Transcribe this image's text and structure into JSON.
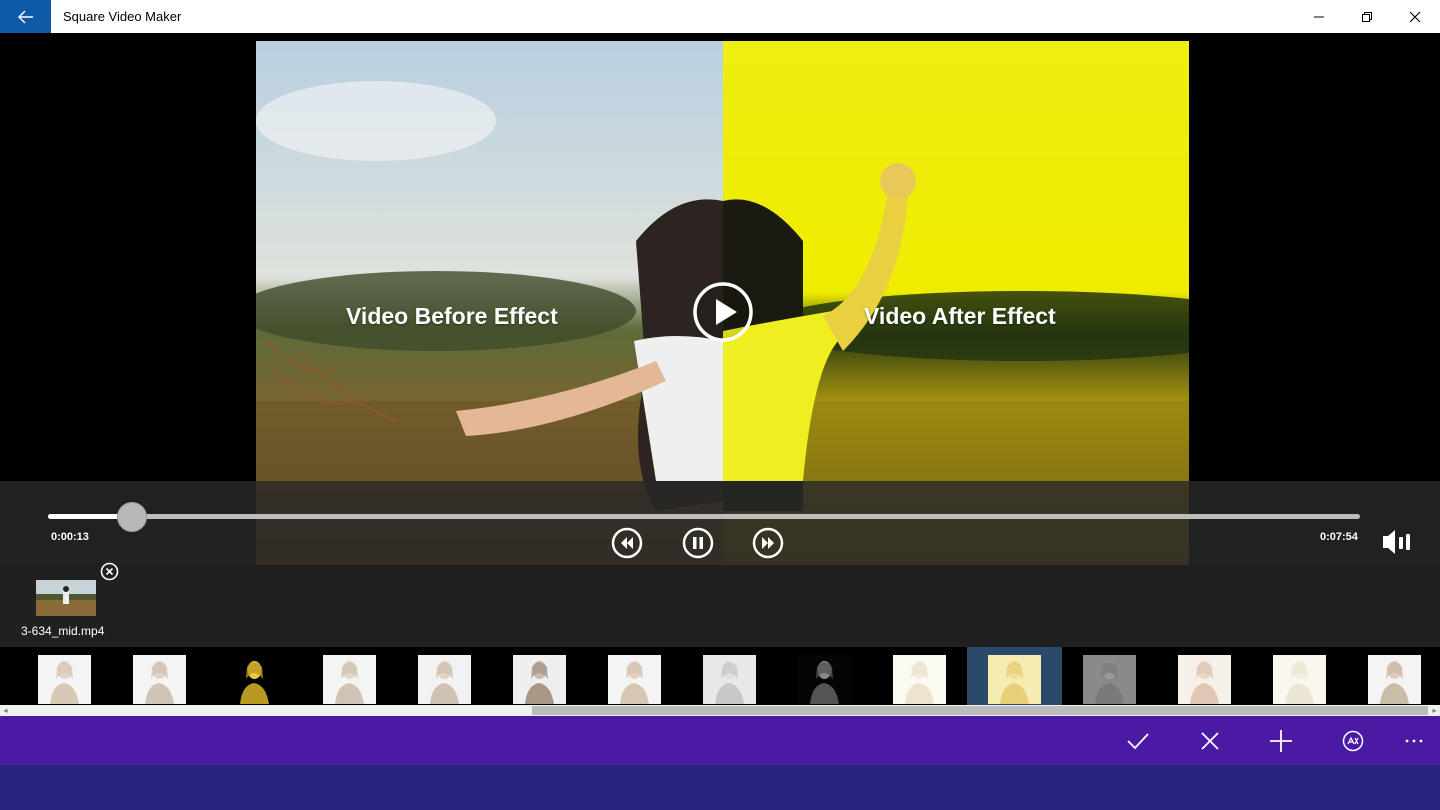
{
  "window": {
    "title": "Square Video Maker"
  },
  "preview": {
    "before_label": "Video Before Effect",
    "after_label": "Video After Effect",
    "after_tint": "#f0ec00"
  },
  "playback": {
    "current_time": "0:00:13",
    "total_time": "0:07:54",
    "progress": 0.064
  },
  "media": {
    "items": [
      {
        "name": "3-634_mid.mp4"
      }
    ]
  },
  "effects": {
    "selected_index": 10,
    "count": 15
  },
  "appbar": {
    "actions": [
      "checkmark-icon",
      "close-icon",
      "add-icon",
      "effects-icon",
      "more-icon"
    ]
  },
  "colors": {
    "accent": "#0e5aa7",
    "appbar": "#4b1aa5",
    "bottom_band": "#2b2380"
  }
}
